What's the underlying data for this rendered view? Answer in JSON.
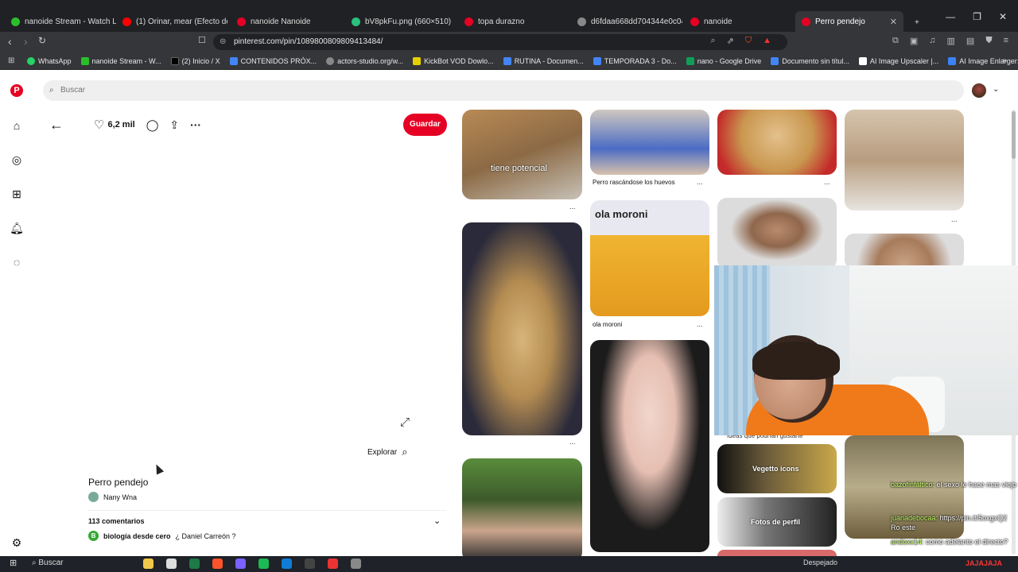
{
  "browser": {
    "tabs": [
      {
        "label": "nanoide Stream - Watch Li",
        "color": "#2bbf2b"
      },
      {
        "label": "(1) Orinar, mear (Efecto de Son",
        "color": "#ff0000"
      },
      {
        "label": "nanoide Nanoide",
        "color": "#e60023"
      },
      {
        "label": "bV8pkFu.png (660×510)",
        "color": "#2bbf80"
      },
      {
        "label": "topa durazno",
        "color": "#e60023"
      },
      {
        "label": "d6fdaa668dd704344e0c04356",
        "color": "#888888"
      },
      {
        "label": "nanoide",
        "color": "#e60023"
      },
      {
        "label": "Perro pendejo",
        "color": "#e60023"
      }
    ],
    "url": "pinterest.com/pin/1089800809809413484/",
    "bookmarks": [
      {
        "label": "WhatsApp",
        "color": "#25d366"
      },
      {
        "label": "nanoide Stream - W...",
        "color": "#2bbf2b"
      },
      {
        "label": "(2) Inicio / X",
        "color": "#000000"
      },
      {
        "label": "CONTENIDOS PRÓX...",
        "color": "#4285f4"
      },
      {
        "label": "actors-studio.org/w...",
        "color": "#888888"
      },
      {
        "label": "KickBot VOD Dowlo...",
        "color": "#e8d000"
      },
      {
        "label": "RUTINA - Documen...",
        "color": "#4285f4"
      },
      {
        "label": "TEMPORADA 3 - Do...",
        "color": "#4285f4"
      },
      {
        "label": "nano - Google Drive",
        "color": "#0f9d58"
      },
      {
        "label": "Documento sin títul...",
        "color": "#4285f4"
      },
      {
        "label": "AI Image Upscaler |...",
        "color": "#ffffff"
      },
      {
        "label": "AI Image Enlarger: E...",
        "color": "#3b82f6"
      }
    ]
  },
  "pinterest": {
    "search_placeholder": "Buscar",
    "likes": "6,2 mil",
    "save_label": "Guardar",
    "explore_label": "Explorar",
    "pin_title": "Perro pendejo",
    "author": "Nany Wna",
    "comments_count": "113 comentarios",
    "first_comment_author": "biología desde cero",
    "first_comment_text": "¿ Daniel Carreón ?",
    "captions": {
      "tile_tiene": "tiene potencial",
      "perro_rascandose": "Perro rascándose los huevos",
      "ola_moroni_text": "ola moroni",
      "ola_moroni": "ola moroni",
      "ideas": "Ideas que podrían gustarte",
      "vegetto": "Vegetto icons",
      "fotos_perfil": "Fotos de perfil"
    },
    "more_dots": "..."
  },
  "stream_chat": [
    {
      "user": "bazofinfaltico:",
      "text": " el sexo le hace mas viejo"
    },
    {
      "user": "juanadebocaa:",
      "text": " https://pin.it/5oxgxQ2 Ro este"
    },
    {
      "user": "andoxx14:",
      "text": " como adelanto el directo?"
    }
  ],
  "taskbar": {
    "search_label": "Buscar",
    "weather": "Despejado",
    "overlay_tail": "JAJAJAJA"
  }
}
